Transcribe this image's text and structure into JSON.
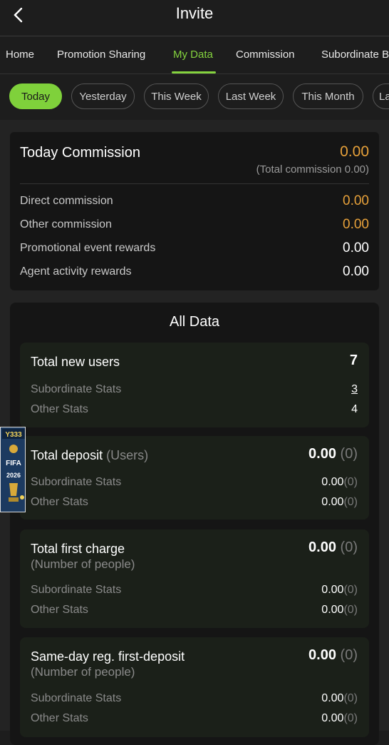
{
  "header": {
    "title": "Invite"
  },
  "tabs": [
    {
      "label": "Home"
    },
    {
      "label": "Promotion Sharing"
    },
    {
      "label": "My Data"
    },
    {
      "label": "Commission"
    },
    {
      "label": "Subordinate B"
    }
  ],
  "periods": [
    {
      "label": "Today"
    },
    {
      "label": "Yesterday"
    },
    {
      "label": "This Week"
    },
    {
      "label": "Last Week"
    },
    {
      "label": "This Month"
    },
    {
      "label": "La"
    }
  ],
  "commission": {
    "title": "Today Commission",
    "amount": "0.00",
    "total": "(Total commission 0.00)",
    "rows": [
      {
        "label": "Direct commission",
        "value": "0.00",
        "color": "#e7a13a"
      },
      {
        "label": "Other commission",
        "value": "0.00",
        "color": "#e7a13a"
      },
      {
        "label": "Promotional event rewards",
        "value": "0.00",
        "color": "#ffffff"
      },
      {
        "label": "Agent activity rewards",
        "value": "0.00",
        "color": "#ffffff"
      }
    ]
  },
  "all_data": {
    "title": "All Data",
    "new_users": {
      "title": "Total new users",
      "value": "7",
      "sub_label": "Subordinate Stats",
      "sub_value": "3",
      "other_label": "Other Stats",
      "other_value": "4"
    },
    "deposit": {
      "title": "Total deposit",
      "title_suffix": "(Users)",
      "value": "0.00",
      "count": "(0)",
      "sub_label": "Subordinate Stats",
      "sub_value": "0.00",
      "sub_count": "(0)",
      "other_label": "Other Stats",
      "other_value": "0.00",
      "other_count": "(0)"
    },
    "first_charge": {
      "title": "Total first charge",
      "subtitle": "(Number of people)",
      "value": "0.00",
      "count": "(0)",
      "sub_label": "Subordinate Stats",
      "sub_value": "0.00",
      "sub_count": "(0)",
      "other_label": "Other Stats",
      "other_value": "0.00",
      "other_count": "(0)"
    },
    "sameday": {
      "title": "Same-day reg. first-deposit",
      "subtitle": "(Number of people)",
      "value": "0.00",
      "count": "(0)",
      "sub_label": "Subordinate Stats",
      "sub_value": "0.00",
      "sub_count": "(0)",
      "other_label": "Other Stats",
      "other_value": "0.00",
      "other_count": "(0)"
    }
  },
  "promo_badge": {
    "brand": "Y333",
    "event": "FIFA",
    "year": "2026"
  },
  "colors": {
    "accent": "#84d33e",
    "amount": "#e7a13a",
    "background": "#1d1d1d"
  }
}
